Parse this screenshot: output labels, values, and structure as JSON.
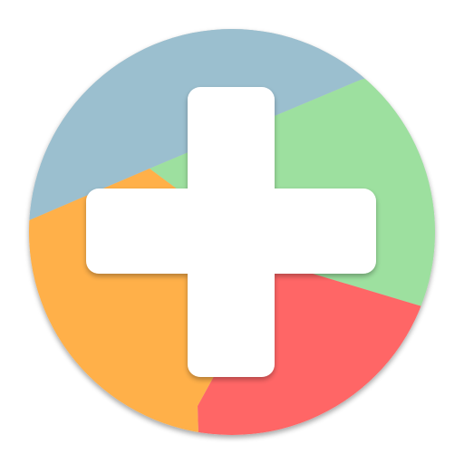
{
  "icon": {
    "name": "plus-icon",
    "style": "circular badge with four colored segments and white plus sign"
  },
  "colors": {
    "segment_top": "#9bbfcf",
    "segment_right": "#9de09f",
    "segment_bottom": "#ff6666",
    "segment_left": "#ffb04a",
    "plus": "#ffffff",
    "background": "#ffffff"
  }
}
